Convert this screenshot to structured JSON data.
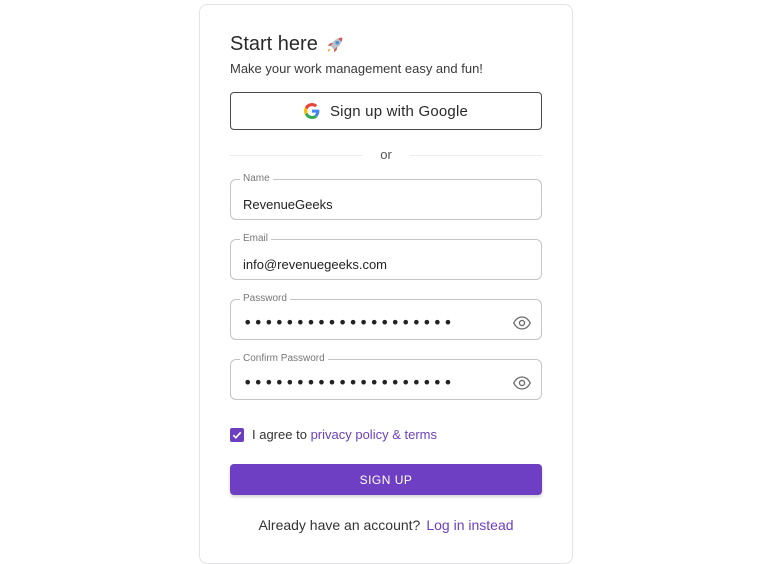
{
  "header": {
    "title": "Start here",
    "title_icon": "rocket-icon",
    "subtitle": "Make your work management easy and fun!"
  },
  "google_button": {
    "label": "Sign up with Google",
    "icon": "google-icon"
  },
  "divider": {
    "text": "or"
  },
  "fields": {
    "name": {
      "label": "Name",
      "value": "RevenueGeeks"
    },
    "email": {
      "label": "Email",
      "value": "info@revenuegeeks.com"
    },
    "password": {
      "label": "Password",
      "masked_value": "••••••••••••••••••••",
      "icon": "eye-icon"
    },
    "confirm_password": {
      "label": "Confirm Password",
      "masked_value": "••••••••••••••••••••",
      "icon": "eye-icon"
    }
  },
  "agree": {
    "checked": true,
    "prefix": "I agree to",
    "link": "privacy policy & terms"
  },
  "signup_button": {
    "label": "SIGN UP"
  },
  "footer": {
    "text": "Already have an account?",
    "link": "Log in instead"
  },
  "colors": {
    "accent": "#6e3fc2",
    "border": "#c4c4c4",
    "text": "#333333"
  }
}
